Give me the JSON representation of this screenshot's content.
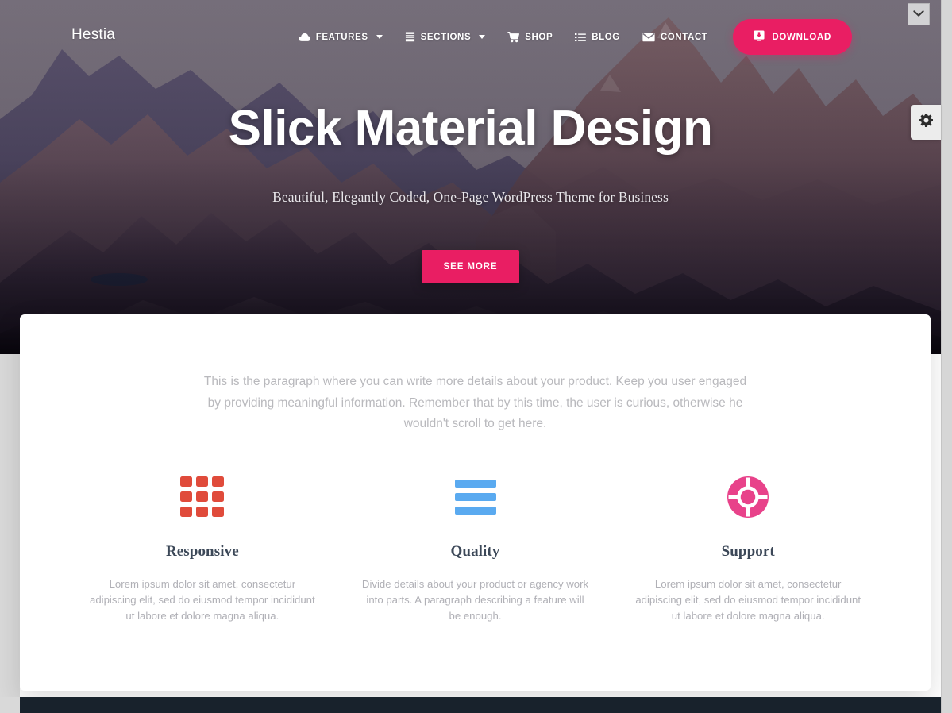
{
  "site": {
    "brand": "Hestia"
  },
  "nav": {
    "items": [
      {
        "label": "FEATURES",
        "icon": "cloud-icon",
        "has_caret": true
      },
      {
        "label": "SECTIONS",
        "icon": "layers-icon",
        "has_caret": true
      },
      {
        "label": "SHOP",
        "icon": "cart-icon",
        "has_caret": false
      },
      {
        "label": "BLOG",
        "icon": "list-icon",
        "has_caret": false
      },
      {
        "label": "CONTACT",
        "icon": "envelope-icon",
        "has_caret": false
      }
    ],
    "download_label": "DOWNLOAD",
    "download_icon": "download-icon"
  },
  "hero": {
    "title": "Slick Material Design",
    "subtitle": "Beautiful, Elegantly Coded, One-Page WordPress Theme for Business",
    "cta_label": "SEE MORE"
  },
  "card": {
    "intro": "This is the paragraph where you can write more details about your product. Keep you user engaged by providing meaningful information. Remember that by this time, the user is curious, otherwise he wouldn't scroll to get here.",
    "features": [
      {
        "icon": "grid-icon",
        "icon_color": "#e04b3b",
        "title": "Responsive",
        "text": "Lorem ipsum dolor sit amet, consectetur adipiscing elit, sed do eiusmod tempor incididunt ut labore et dolore magna aliqua."
      },
      {
        "icon": "align-justify-icon",
        "icon_color": "#5aaaf0",
        "title": "Quality",
        "text": "Divide details about your product or agency work into parts. A paragraph describing a feature will be enough."
      },
      {
        "icon": "life-ring-icon",
        "icon_color": "#e8428a",
        "title": "Support",
        "text": "Lorem ipsum dolor sit amet, consectetur adipiscing elit, sed do eiusmod tempor incididunt ut labore et dolore magna aliqua."
      }
    ]
  },
  "controls": {
    "collapse_icon": "chevron-down-icon",
    "settings_icon": "gear-icon"
  },
  "colors": {
    "accent_pink": "#e91e63",
    "heading_dark": "#3c4858",
    "footer_dark": "#18222c"
  }
}
